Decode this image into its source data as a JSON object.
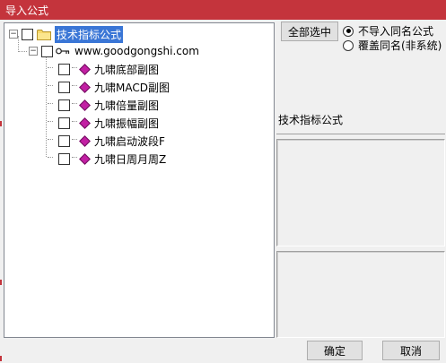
{
  "window": {
    "title": "导入公式"
  },
  "tree": {
    "root_label": "技术指标公式",
    "site_label": "www.goodgongshi.com",
    "items": [
      {
        "label": "九啸底部副图"
      },
      {
        "label": "九啸MACD副图"
      },
      {
        "label": "九啸倍量副图"
      },
      {
        "label": "九啸振幅副图"
      },
      {
        "label": "九啸启动波段F"
      },
      {
        "label": "九啸日周月周Z"
      }
    ]
  },
  "options": {
    "select_all_label": "全部选中",
    "radio_skip_label": "不导入同名公式",
    "radio_overwrite_label": "覆盖同名(非系统)",
    "selected_radio": "skip"
  },
  "info": {
    "category_label": "技术指标公式"
  },
  "footer": {
    "ok_label": "确定",
    "cancel_label": "取消"
  }
}
